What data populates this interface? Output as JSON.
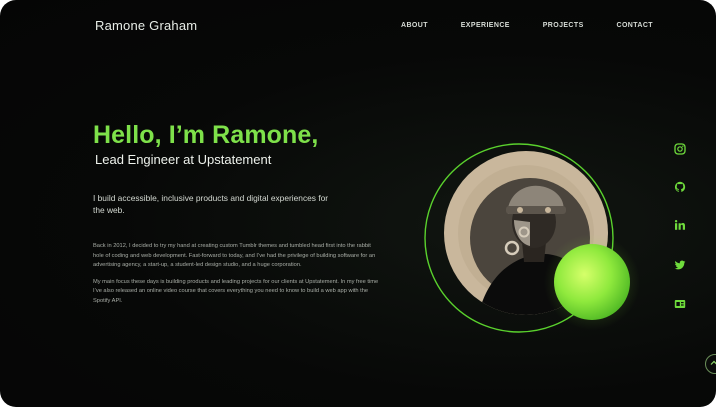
{
  "brand": {
    "name": "Ramone Graham"
  },
  "nav": {
    "items": [
      {
        "label": "ABOUT"
      },
      {
        "label": "EXPERIENCE"
      },
      {
        "label": "PROJECTS"
      },
      {
        "label": "CONTACT"
      }
    ]
  },
  "hero": {
    "greeting": "Hello, I’m Ramone,",
    "role": "Lead Engineer at Upstatement",
    "intro": "I build accessible, inclusive products and digital experiences for the web.",
    "paragraphs": [
      "Back in 2012, I decided to try my hand at creating custom Tumblr themes and tumbled head first into the rabbit hole of coding and web development. Fast-forward to today, and I’ve had the privilege of building software for an advertising agency, a start-up, a student-led design studio, and a huge corporation.",
      "My main focus these days is building products and leading projects for our clients at Upstatement. In my free time I’ve also released an online video course that covers everything you need to know to build a web app with the Spotify API."
    ]
  },
  "social": {
    "icons": [
      "instagram-icon",
      "github-icon",
      "linkedin-icon",
      "twitter-icon",
      "codepen-icon"
    ]
  },
  "colors": {
    "accent": "#7ee14a",
    "background": "#060706",
    "portrait_disc": "#c9b79c",
    "text": "#eef2ec"
  }
}
